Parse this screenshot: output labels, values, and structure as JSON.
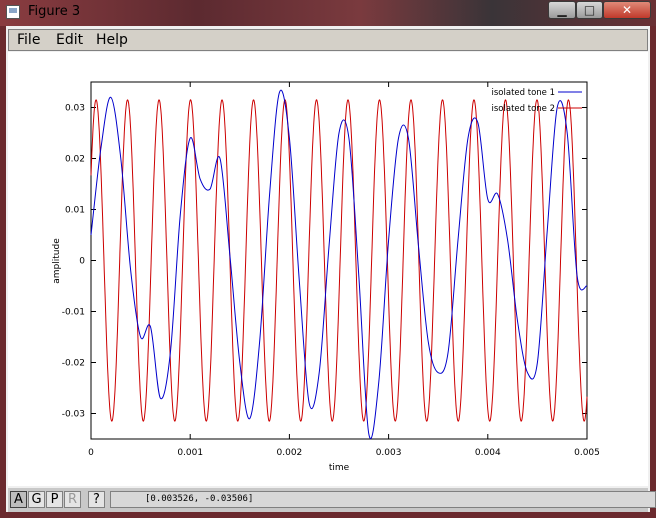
{
  "window": {
    "title": "Figure 3",
    "minimize_glyph": "▁",
    "maximize_glyph": "□",
    "close_glyph": "✕"
  },
  "menu": {
    "items": [
      "File",
      "Edit",
      "Help"
    ]
  },
  "toolbar": {
    "buttons": [
      {
        "label": "A",
        "state": "pressed"
      },
      {
        "label": "G",
        "state": "normal"
      },
      {
        "label": "P",
        "state": "normal"
      },
      {
        "label": "R",
        "state": "disabled"
      },
      {
        "label": "?",
        "state": "normal"
      }
    ],
    "coordinates": "[0.003526, -0.03506]"
  },
  "chart_data": {
    "type": "line",
    "xlabel": "time",
    "ylabel": "amplitude",
    "xlim": [
      0,
      0.005
    ],
    "ylim": [
      -0.035,
      0.035
    ],
    "xticks": [
      0,
      0.001,
      0.002,
      0.003,
      0.004,
      0.005
    ],
    "xtick_labels": [
      "0",
      "0.001",
      "0.002",
      "0.003",
      "0.004",
      "0.005"
    ],
    "yticks": [
      0.03,
      0.02,
      0.01,
      0,
      -0.01,
      -0.02,
      -0.03
    ],
    "ytick_labels": [
      "0.03",
      "0.02",
      "0.01",
      "0",
      "-0.01",
      "-0.02",
      "-0.03"
    ],
    "grid": false,
    "legend_position": "top-right",
    "series": [
      {
        "name": "isolated tone 1",
        "color": "#0000cc",
        "x": [
          0,
          0.0001,
          0.0002,
          0.0003,
          0.0004,
          0.0005,
          0.0006,
          0.0007,
          0.0008,
          0.0009,
          0.001,
          0.0011,
          0.0012,
          0.0013,
          0.0014,
          0.0015,
          0.0016,
          0.0017,
          0.0018,
          0.0019,
          0.002,
          0.0021,
          0.0022,
          0.0023,
          0.0024,
          0.0025,
          0.0026,
          0.0027,
          0.0028,
          0.0029,
          0.003,
          0.0031,
          0.0032,
          0.0033,
          0.0034,
          0.0035,
          0.0036,
          0.0037,
          0.0038,
          0.0039,
          0.004,
          0.0041,
          0.0042,
          0.0043,
          0.0044,
          0.0045,
          0.0046,
          0.0047,
          0.0048,
          0.0049,
          0.005
        ],
        "y": [
          0.005,
          0.022,
          0.032,
          0.02,
          -0.002,
          -0.015,
          -0.013,
          -0.027,
          -0.018,
          0.009,
          0.024,
          0.016,
          0.014,
          0.02,
          0.001,
          -0.02,
          -0.031,
          -0.016,
          0.013,
          0.033,
          0.024,
          -0.004,
          -0.028,
          -0.022,
          0.003,
          0.025,
          0.024,
          -0.003,
          -0.034,
          -0.024,
          0.004,
          0.024,
          0.024,
          0.003,
          -0.016,
          -0.022,
          -0.018,
          0.004,
          0.024,
          0.027,
          0.012,
          0.013,
          0.004,
          -0.012,
          -0.022,
          -0.02,
          0.006,
          0.03,
          0.025,
          -0.003,
          -0.005
        ]
      },
      {
        "name": "isolated tone 2",
        "color": "#cc0000",
        "freq_hz": 3150,
        "amplitude": 0.0315,
        "phase_deg": 32
      }
    ]
  }
}
